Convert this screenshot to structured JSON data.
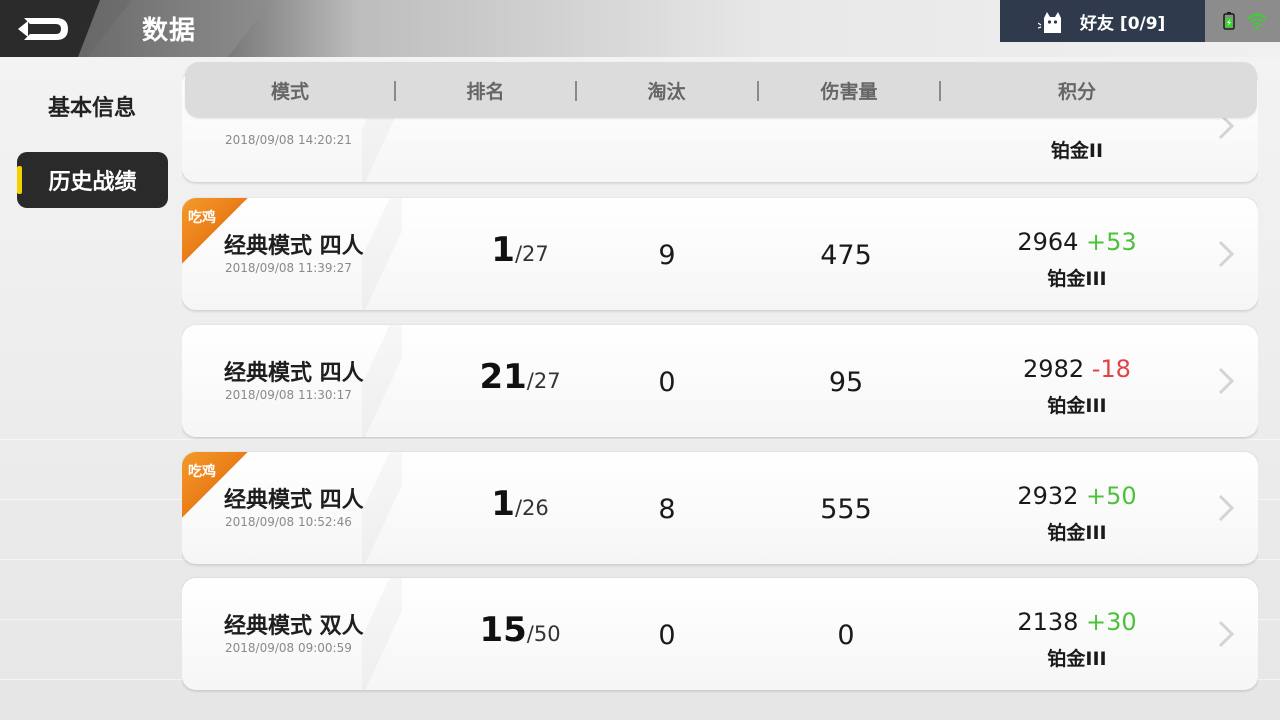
{
  "header": {
    "title": "数据",
    "friends_label": "好友 [0/9]"
  },
  "sidebar": {
    "basic_info": "基本信息",
    "history": "历史战绩"
  },
  "table": {
    "columns": [
      "模式",
      "排名",
      "淘汰",
      "伤害量",
      "积分"
    ]
  },
  "rows": [
    {
      "win": false,
      "mode": "",
      "time": "2018/09/08   14:20:21",
      "rank": "",
      "total": "",
      "kills": "",
      "damage": "",
      "score": "",
      "delta": "",
      "tier": "铂金II"
    },
    {
      "win": true,
      "win_label": "吃鸡",
      "mode": "经典模式 四人",
      "time": "2018/09/08   11:39:27",
      "rank": "1",
      "total": "/27",
      "kills": "9",
      "damage": "475",
      "score": "2964",
      "delta": "+53",
      "tier": "铂金III"
    },
    {
      "win": false,
      "mode": "经典模式 四人",
      "time": "2018/09/08   11:30:17",
      "rank": "21",
      "total": "/27",
      "kills": "0",
      "damage": "95",
      "score": "2982",
      "delta": "-18",
      "tier": "铂金III"
    },
    {
      "win": true,
      "win_label": "吃鸡",
      "mode": "经典模式 四人",
      "time": "2018/09/08   10:52:46",
      "rank": "1",
      "total": "/26",
      "kills": "8",
      "damage": "555",
      "score": "2932",
      "delta": "+50",
      "tier": "铂金III"
    },
    {
      "win": false,
      "mode": "经典模式 双人",
      "time": "2018/09/08   09:00:59",
      "rank": "15",
      "total": "/50",
      "kills": "0",
      "damage": "0",
      "score": "2138",
      "delta": "+30",
      "tier": "铂金III"
    }
  ],
  "colors": {
    "positive": "#4cc23a",
    "negative": "#e04444",
    "win_tag": "#f39a2b",
    "accent_marker": "#f5d000"
  }
}
